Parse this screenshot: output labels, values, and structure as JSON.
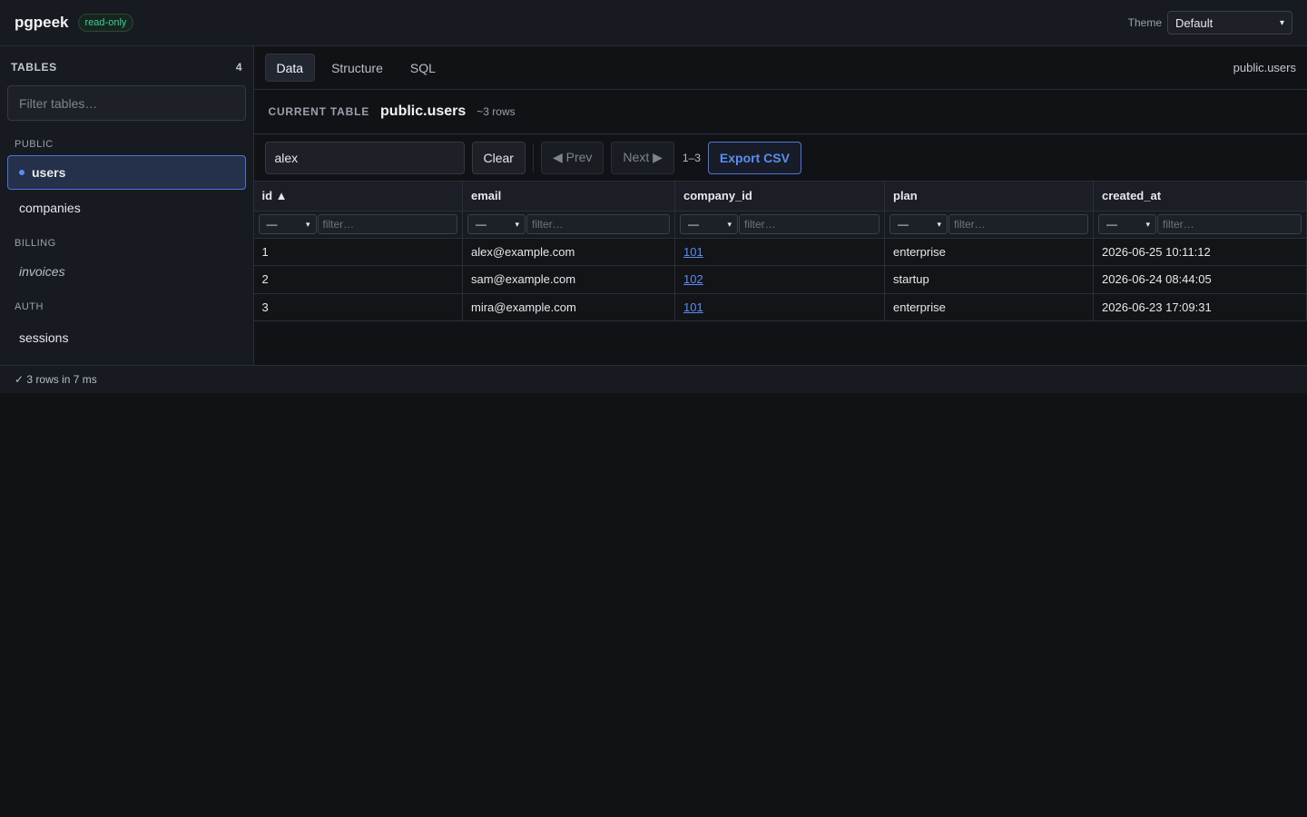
{
  "app": {
    "title": "pgpeek",
    "badge": "read-only"
  },
  "theme": {
    "label": "Theme",
    "selected": "Default"
  },
  "sidebar": {
    "heading": "TABLES",
    "count": "4",
    "filter_placeholder": "Filter tables…",
    "groups": [
      {
        "label": "PUBLIC",
        "items": [
          {
            "label": "users"
          },
          {
            "label": "companies"
          }
        ]
      },
      {
        "label": "BILLING",
        "items": [
          {
            "label": "invoices"
          }
        ]
      },
      {
        "label": "AUTH",
        "items": [
          {
            "label": "sessions"
          }
        ]
      }
    ]
  },
  "tabs": {
    "items": [
      {
        "label": "Data"
      },
      {
        "label": "Structure"
      },
      {
        "label": "SQL"
      }
    ],
    "path": "public.users"
  },
  "current": {
    "label": "CURRENT TABLE",
    "name": "public.users",
    "rows": "~3 rows"
  },
  "toolbar": {
    "search_value": "alex",
    "clear": "Clear",
    "prev": "◀ Prev",
    "next": "Next ▶",
    "range": "1–3",
    "export": "Export CSV"
  },
  "table": {
    "columns": [
      "id ▲",
      "email",
      "company_id",
      "plan",
      "created_at"
    ],
    "filter_op": "—",
    "filter_placeholder": "filter…",
    "rows": [
      [
        "1",
        "alex@example.com",
        "101",
        "enterprise",
        "2026-06-25 10:11:12"
      ],
      [
        "2",
        "sam@example.com",
        "102",
        "startup",
        "2026-06-24 08:44:05"
      ],
      [
        "3",
        "mira@example.com",
        "101",
        "enterprise",
        "2026-06-23 17:09:31"
      ]
    ]
  },
  "status": {
    "text": "✓ 3 rows in 7 ms"
  },
  "colors": {
    "accent": "#5b8def",
    "success": "#3ecf8e",
    "background": "#111216"
  }
}
